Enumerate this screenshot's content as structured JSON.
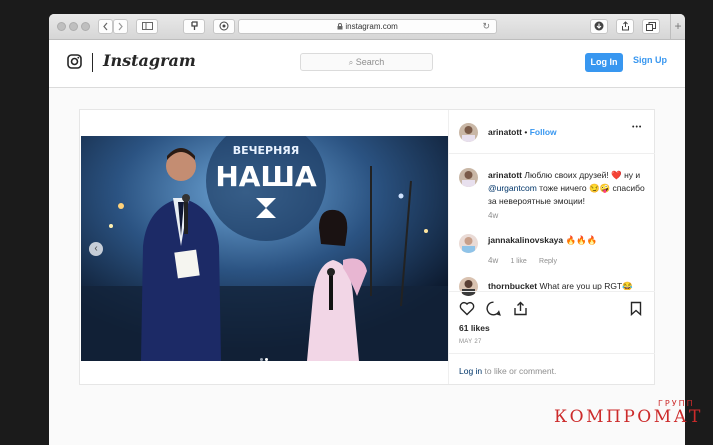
{
  "browser": {
    "url": "instagram.com",
    "new_tab_label": "+"
  },
  "header": {
    "wordmark": "Instagram",
    "search_placeholder": "Search",
    "login_label": "Log In",
    "signup_label": "Sign Up"
  },
  "post": {
    "username": "arinatott",
    "follow_separator": "•",
    "follow_label": "Follow",
    "more_label": "•••",
    "photo_signboard": [
      "ВЕЧЕРНЯЯ",
      "НАША"
    ],
    "comments": [
      {
        "username": "arinatott",
        "text_before": "Люблю своих друзей! ",
        "emoji_1": "❤️",
        "text_mid": " ну и ",
        "mention": "@urgantcom",
        "text_after": " тоже ничего ",
        "emoji_2": "😏🤪",
        "text_last": " спасибо за невероятные эмоции!",
        "time": "4w"
      },
      {
        "username": "jannakalinovskaya",
        "text": "🔥🔥🔥",
        "time": "4w",
        "likes": "1 like",
        "reply": "Reply"
      },
      {
        "username": "thornbucket",
        "text": "What are you up RGT😂"
      }
    ],
    "likes": "61 likes",
    "date": "MAY 27",
    "login_prompt_link": "Log in",
    "login_prompt_rest": " to like or comment."
  },
  "watermark": {
    "main": "КОМПРОМАТ",
    "small": "ГРУПП"
  },
  "colors": {
    "accent": "#3897f0",
    "watermark": "#cc2b2b"
  }
}
